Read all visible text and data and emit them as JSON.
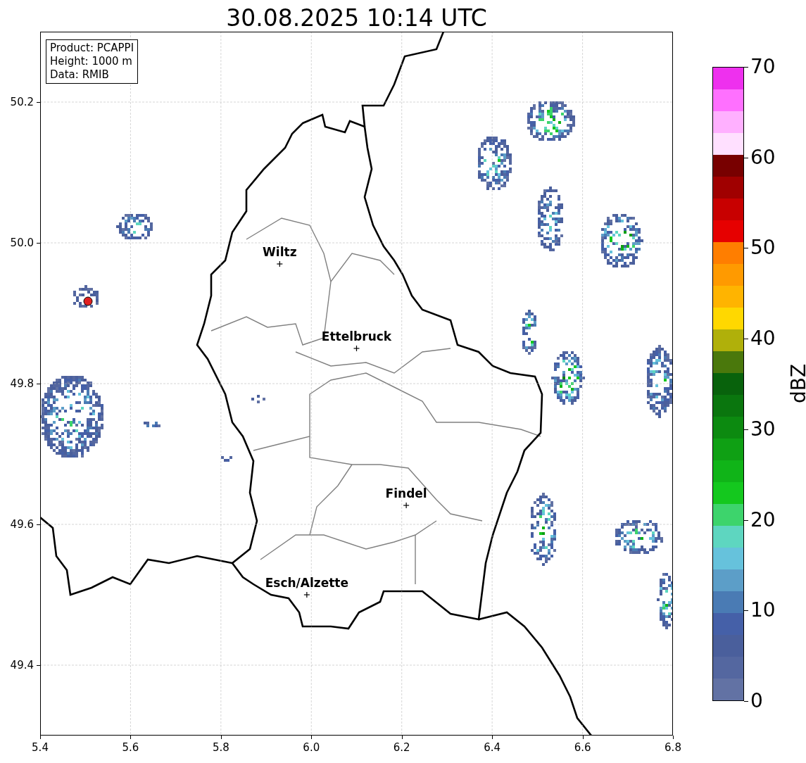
{
  "title": "30.08.2025 10:14 UTC",
  "info_box": [
    "Product: PCAPPI",
    "Height: 1000 m",
    "Data: RMIB"
  ],
  "chart_data": {
    "type": "scatter",
    "grid": true,
    "xlim": [
      5.4,
      6.8
    ],
    "ylim": [
      49.3,
      50.3
    ],
    "xticks": [
      {
        "value": 5.4,
        "label": "5.4"
      },
      {
        "value": 5.6,
        "label": "5.6"
      },
      {
        "value": 5.8,
        "label": "5.8"
      },
      {
        "value": 6.0,
        "label": "6.0"
      },
      {
        "value": 6.2,
        "label": "6.2"
      },
      {
        "value": 6.4,
        "label": "6.4"
      },
      {
        "value": 6.6,
        "label": "6.6"
      },
      {
        "value": 6.8,
        "label": "6.8"
      }
    ],
    "yticks": [
      {
        "value": 49.4,
        "label": "49.4"
      },
      {
        "value": 49.6,
        "label": "49.6"
      },
      {
        "value": 49.8,
        "label": "49.8"
      },
      {
        "value": 50.0,
        "label": "50.0"
      },
      {
        "value": 50.2,
        "label": "50.2"
      }
    ],
    "series": [
      {
        "color": "#000000",
        "x": [
          5.93,
          6.1,
          6.21,
          5.99
        ],
        "values": [
          49.97,
          49.85,
          49.627,
          49.5
        ]
      }
    ],
    "annotations": [
      "Wiltz",
      "Ettelbruck",
      "Findel",
      "Esch/Alzette"
    ]
  },
  "colorbar": {
    "label": "dBZ",
    "ticks": [
      "70",
      "60",
      "50",
      "40",
      "30",
      "20",
      "10",
      "0"
    ],
    "levels": [
      {
        "color": "#6272a4"
      },
      {
        "color": "#5467a0"
      },
      {
        "color": "#4a5f9c"
      },
      {
        "color": "#4560a8"
      },
      {
        "color": "#4a7bb4"
      },
      {
        "color": "#5c9ec8"
      },
      {
        "color": "#66c2dc"
      },
      {
        "color": "#5ed6c0"
      },
      {
        "color": "#3dd46c"
      },
      {
        "color": "#14c81e"
      },
      {
        "color": "#10b418"
      },
      {
        "color": "#0fa014"
      },
      {
        "color": "#0c8a10"
      },
      {
        "color": "#0a760e"
      },
      {
        "color": "#08620c"
      },
      {
        "color": "#4a780c"
      },
      {
        "color": "#b0b00a"
      },
      {
        "color": "#ffd800"
      },
      {
        "color": "#ffb400"
      },
      {
        "color": "#ff9a00"
      },
      {
        "color": "#ff7e00"
      },
      {
        "color": "#e60000"
      },
      {
        "color": "#c80000"
      },
      {
        "color": "#a00000"
      },
      {
        "color": "#780000"
      },
      {
        "color": "#ffe0ff"
      },
      {
        "color": "#ffb0ff"
      },
      {
        "color": "#ff70ff"
      },
      {
        "color": "#ee30ee"
      }
    ]
  }
}
